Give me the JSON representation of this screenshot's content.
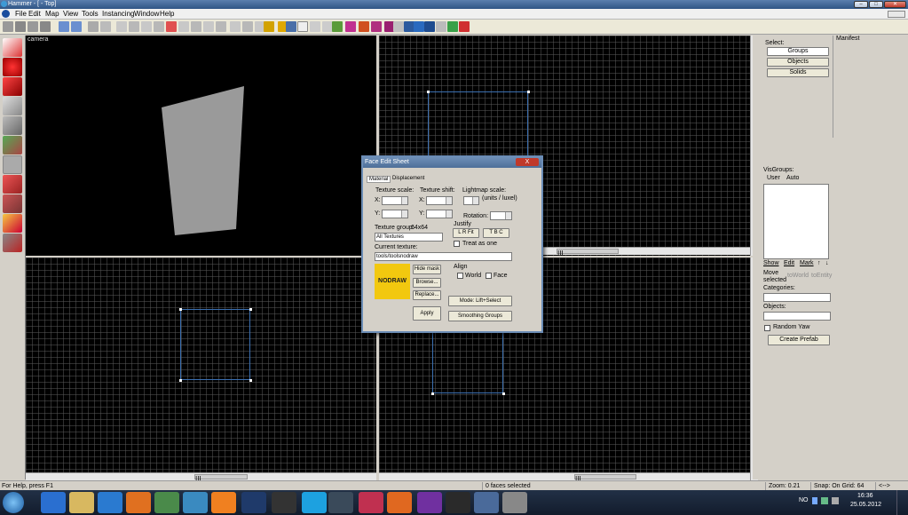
{
  "window": {
    "title": "Hammer - [ - Top]",
    "min_glyph": "–",
    "max_glyph": "□",
    "close_glyph": "✕"
  },
  "menu": [
    "File",
    "Edit",
    "Map",
    "View",
    "Tools",
    "Instancing",
    "Window",
    "Help"
  ],
  "views": {
    "camera_label": "camera",
    "scroll_thumb": "III"
  },
  "right_panel": {
    "select_label": "Select:",
    "manifest_label": "Manifest",
    "select_buttons": [
      "Groups",
      "Objects",
      "Solids"
    ],
    "visgroups_label": "VisGroups:",
    "tabs": [
      "User",
      "Auto"
    ],
    "vis_buttons": {
      "show": "Show",
      "edit": "Edit",
      "mark": "Mark",
      "up": "↑",
      "down": "↓"
    },
    "move_selected": "Move selected",
    "to_world": "toWorld",
    "to_entity": "toEntity",
    "categories_label": "Categories:",
    "objects_label": "Objects:",
    "random_yaw": "Random Yaw",
    "create_prefab": "Create Prefab"
  },
  "dialog": {
    "title": "Face Edit Sheet",
    "close": "X",
    "tabs": [
      "Material",
      "Displacement"
    ],
    "texture_scale": "Texture scale:",
    "texture_shift": "Texture shift:",
    "lightmap_scale": "Lightmap scale:",
    "units": "(units / luxel)",
    "x_label": "X:",
    "y_label": "Y:",
    "rotation": "Rotation:",
    "justify_label": "Justify",
    "justify_lr": "L  R  Fit",
    "justify_tbc": "T  B  C",
    "treat_as_one": "Treat as one",
    "texture_group_label": "Texture group:",
    "texture_size": "64x64",
    "texture_group_value": "All Textures",
    "current_texture_label": "Current texture:",
    "current_texture_value": "tools/toolsnodraw",
    "preview_text": "NODRAW",
    "hide_mask": "Hide mask",
    "browse": "Browse...",
    "replace": "Replace...",
    "apply": "Apply",
    "align_label": "Align",
    "align_world": "World",
    "align_face": "Face",
    "mode": "Mode: Lift+Select",
    "smoothing": "Smoothing Groups"
  },
  "status": {
    "help": "For Help, press F1",
    "faces": "0 faces selected",
    "zoom": "Zoom: 0.21",
    "snap": "Snap: On Grid: 64",
    "arrow": "<-->"
  },
  "tray": {
    "lang": "NO",
    "time": "16:36",
    "date": "25.05.2012"
  },
  "colors": {
    "accent": "#2f5585",
    "selection": "#3b6fb0",
    "nodraw": "#f2c80f"
  }
}
